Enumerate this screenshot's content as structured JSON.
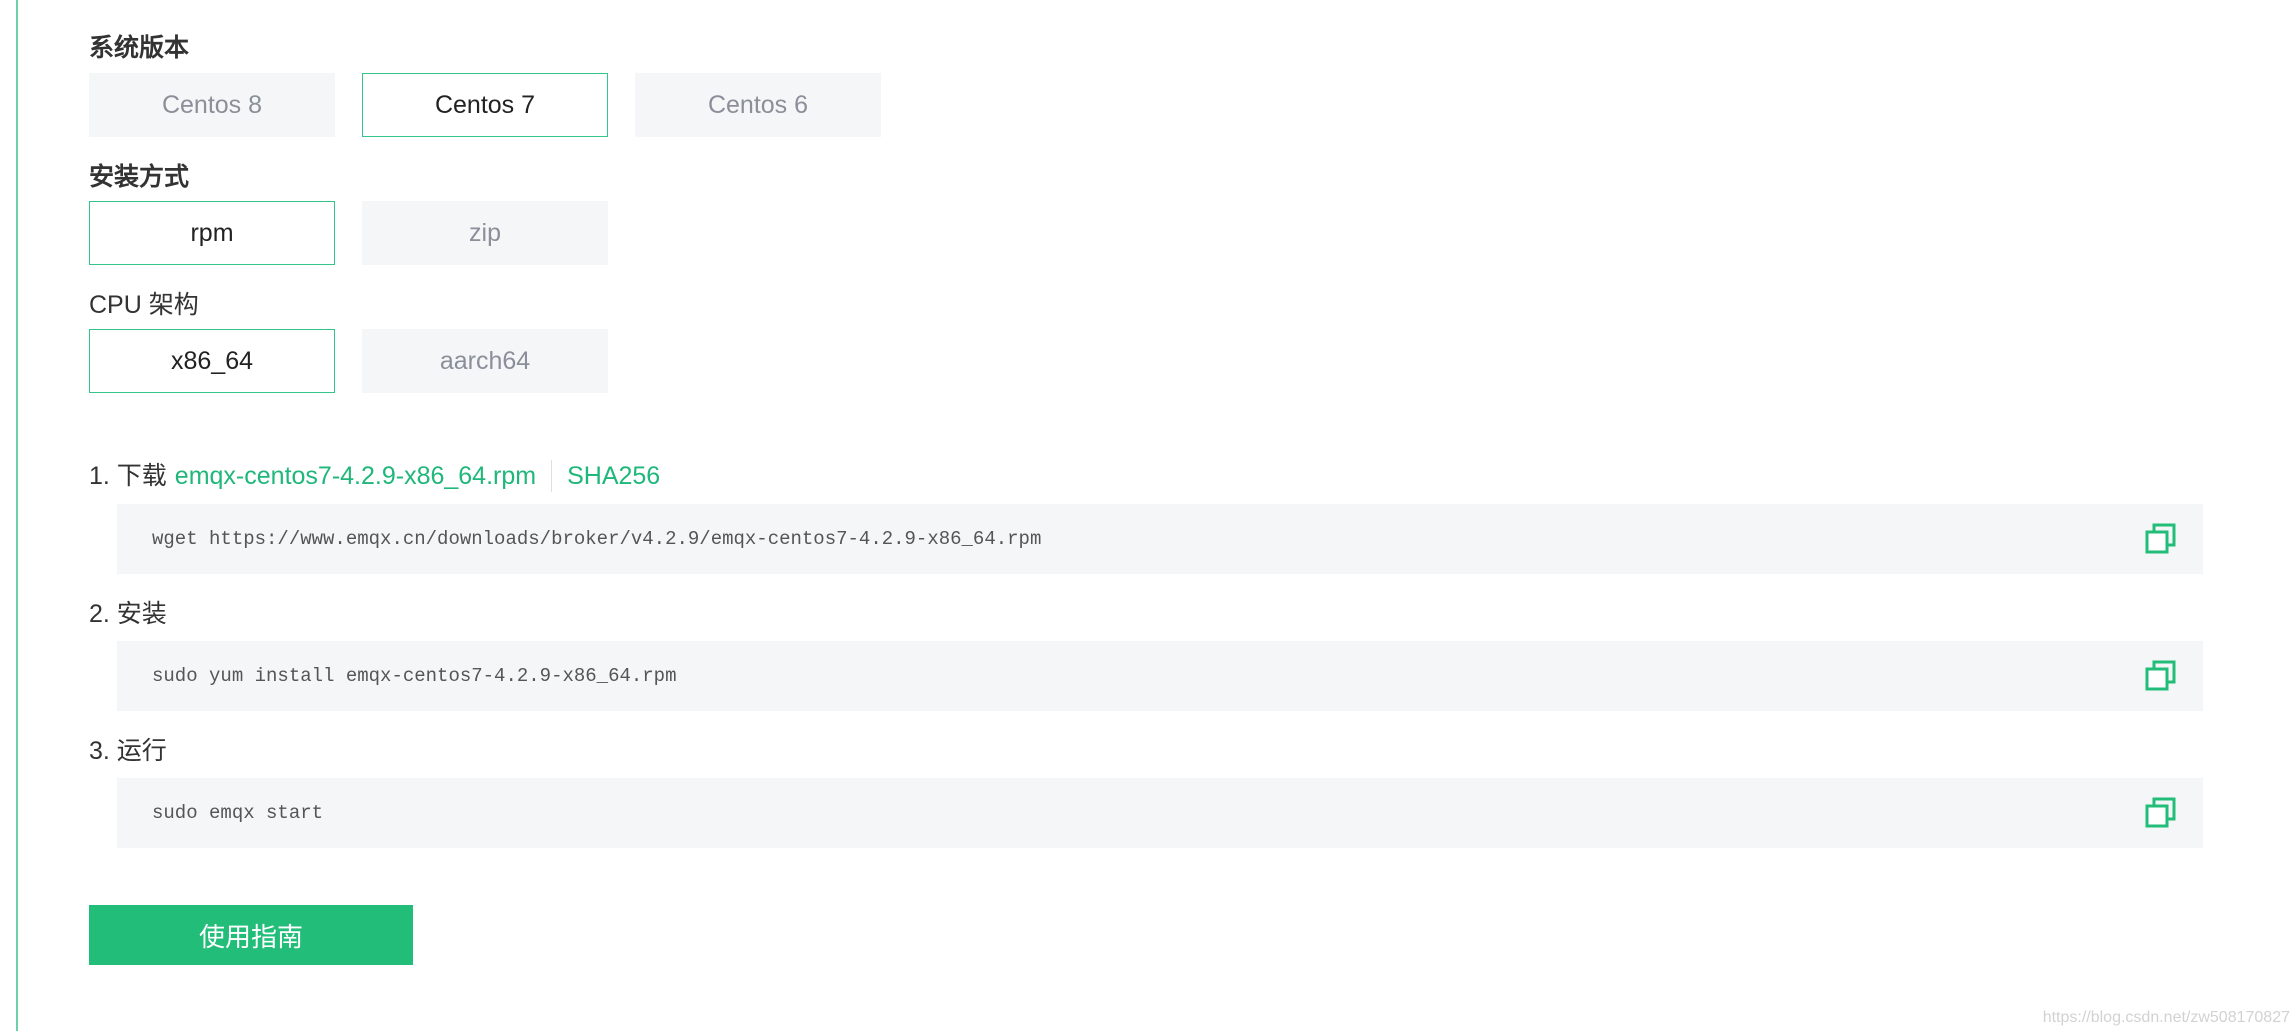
{
  "system_version": {
    "label": "系统版本",
    "options": [
      "Centos 8",
      "Centos 7",
      "Centos 6"
    ],
    "selected": "Centos 7"
  },
  "install_method": {
    "label": "安装方式",
    "options": [
      "rpm",
      "zip"
    ],
    "selected": "rpm"
  },
  "cpu_arch": {
    "label": "CPU 架构",
    "options": [
      "x86_64",
      "aarch64"
    ],
    "selected": "x86_64"
  },
  "steps": [
    {
      "prefix": "1. 下载",
      "link_text": "emqx-centos7-4.2.9-x86_64.rpm",
      "hash_text": "SHA256",
      "command": "wget https://www.emqx.cn/downloads/broker/v4.2.9/emqx-centos7-4.2.9-x86_64.rpm"
    },
    {
      "prefix": "2. 安装",
      "command": "sudo yum install emqx-centos7-4.2.9-x86_64.rpm"
    },
    {
      "prefix": "3. 运行",
      "command": "sudo emqx start"
    }
  ],
  "guide_button_label": "使用指南",
  "watermark": "https://blog.csdn.net/zw508170827",
  "icons": {
    "copy": "copy-icon"
  },
  "colors": {
    "accent": "#22bd79",
    "active_border": "#33c58a",
    "option_bg": "#f5f6f8",
    "code_bg": "#f5f6f8"
  }
}
